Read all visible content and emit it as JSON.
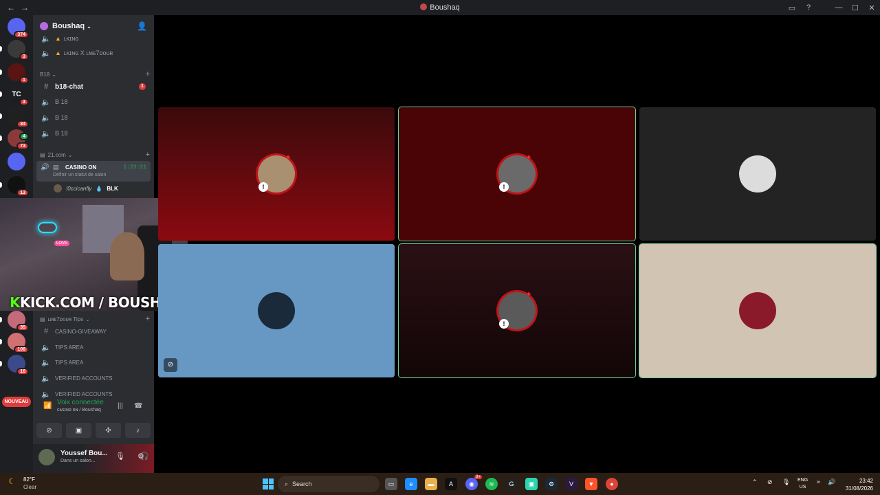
{
  "window": {
    "title": "Boushaq",
    "nav_back": "←",
    "nav_fwd": "→",
    "controls": [
      "▭",
      "?",
      "—",
      "☐",
      "✕"
    ]
  },
  "rail": {
    "servers": [
      {
        "label": "",
        "badge": "374",
        "color": "#5865f2"
      },
      {
        "label": "",
        "badge": "3",
        "color": "#3a3a3a"
      },
      {
        "label": "",
        "badge": "1",
        "color": "#5a1414"
      },
      {
        "label": "TC",
        "badge": "3",
        "color": "#1e1f22"
      },
      {
        "label": "",
        "badge": "34",
        "color": "#202020"
      },
      {
        "label": "",
        "badge": "73",
        "badge2": "4",
        "color": "#8a3a3a"
      },
      {
        "label": "",
        "badge": "",
        "color": "#5865f2"
      },
      {
        "label": "",
        "badge": "13",
        "color": "#111111"
      },
      {
        "label": "",
        "badge": "35",
        "color": "#c46a7a"
      },
      {
        "label": "",
        "badge": "106",
        "color": "#d07070"
      },
      {
        "label": "",
        "badge": "16",
        "color": "#3a4a8a"
      }
    ],
    "nouveau": "NOUVEAU"
  },
  "sidebar": {
    "server_name": "Boushaq",
    "channels_top": [
      {
        "name": "ʟᴋɪɴɢ",
        "icon": "🔈"
      },
      {
        "name": "ʟᴋɪɴɢ X ʟᴍᴇ7ᴅᴏᴜʀ",
        "icon": "🔈"
      }
    ],
    "cat_b18": "B18",
    "b18_chat": "b18-chat",
    "b18_chat_badge": "1",
    "b18_voice": [
      "B 18",
      "B 18",
      "B 18"
    ],
    "cat_21": "21.com",
    "active_channel": "CASINO ON",
    "active_time": "1:23:21",
    "active_status": "Définir un statut de salon",
    "members": [
      "!0ccicanfly",
      "BLK"
    ],
    "cat_tips": "ʟᴍᴇ7ᴅᴏᴜʀ Tips",
    "tips_channels": [
      {
        "name": "CASINO-GIVEAWAY",
        "icon": "#"
      },
      {
        "name": "TIPS AREA",
        "icon": "🔈"
      },
      {
        "name": "TIPS AREA",
        "icon": "🔈"
      },
      {
        "name": "VERIFIED ACCOUNTS",
        "icon": "🔈"
      },
      {
        "name": "VERIFIED ACCOUNTS",
        "icon": "🔈"
      }
    ],
    "voice_connected": "Voix connectée",
    "voice_sub": "ᴄᴀsɪɴᴏ ᴏɴ / Boushaq",
    "user_name": "Youssef Bou...",
    "user_status": "Dans un salon..."
  },
  "webcam": {
    "love": "LOVE",
    "kick_k": "K",
    "kick_text": "KICK.COM / BOUSHAQ"
  },
  "tiles": [
    {
      "bg": "linear-gradient(180deg,#3a0a0c 0%,#8a0a10 100%)",
      "speaking": false,
      "avatar": "#a89070",
      "crown": true,
      "muted": true
    },
    {
      "bg": "#4a0406",
      "speaking": true,
      "avatar": "#6a6a6a",
      "crown": true,
      "muted": true
    },
    {
      "bg": "#232323",
      "speaking": false,
      "avatar": "#dcdcdc",
      "crown": false,
      "muted": false
    },
    {
      "bg": "#6798c3",
      "speaking": false,
      "avatar": "#1a2a3a",
      "crown": false,
      "muted": false,
      "camoff": true
    },
    {
      "bg": "linear-gradient(180deg,#2a1014 0%,#120606 100%)",
      "speaking": true,
      "avatar": "#5a5a5a",
      "crown": true,
      "muted": true
    },
    {
      "bg": "#d1c4b2",
      "speaking": true,
      "avatar": "#8a1a2a",
      "crown": false,
      "muted": false
    }
  ],
  "taskbar": {
    "temp": "82°F",
    "condition": "Clear",
    "search": "Search",
    "lang1": "ENG",
    "lang2": "US",
    "time": "23:42",
    "date": "31/08/2026",
    "discord_badge": "9+"
  }
}
